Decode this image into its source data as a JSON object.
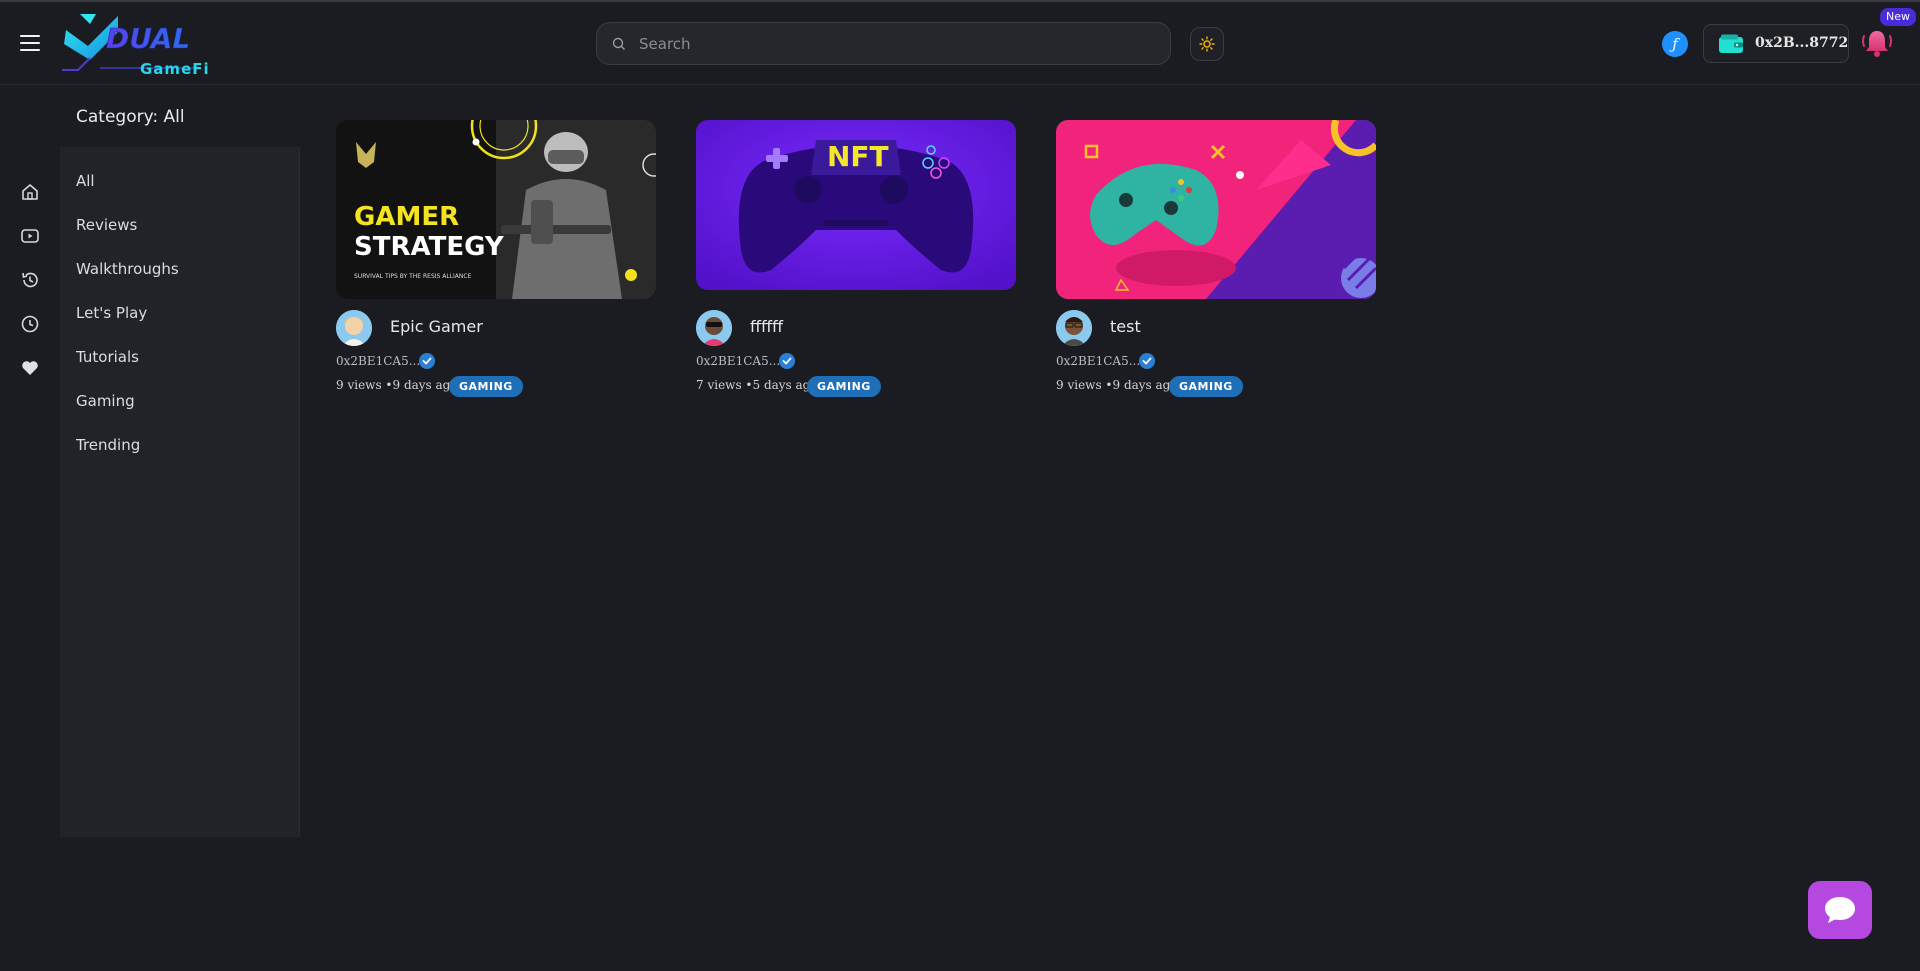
{
  "header": {
    "logo_text": "GameFi",
    "logo_wordmark": "DUAL",
    "search_placeholder": "Search",
    "wallet_address": "0x2B...8772",
    "notification_badge": "New"
  },
  "category_panel": {
    "title": "Category: All",
    "items": [
      "All",
      "Reviews",
      "Walkthroughs",
      "Let's Play",
      "Tutorials",
      "Gaming",
      "Trending"
    ]
  },
  "videos": [
    {
      "title": "Epic Gamer",
      "address": "0x2BE1CA5...",
      "meta": "9 views •9 days ago",
      "tag": "GAMING",
      "thumb_heading_1": "GAMER",
      "thumb_heading_2": "STRATEGY",
      "thumb_caption": "SURVIVAL TIPS BY THE RESIS ALLIANCE"
    },
    {
      "title": "ffffff",
      "address": "0x2BE1CA5...",
      "meta": "7 views •5 days ago",
      "tag": "GAMING",
      "thumb_heading_1": "NFT"
    },
    {
      "title": "test",
      "address": "0x2BE1CA5...",
      "meta": "9 views •9 days ago",
      "tag": "GAMING"
    }
  ],
  "colors": {
    "background": "#1b1c21",
    "panel": "#222328",
    "accent_cyan": "#27d8e8",
    "tag_blue": "#1f6fb8",
    "chat_purple": "#b548e0",
    "bell_pink": "#e0457b"
  },
  "icons": {
    "rail": [
      "home-icon",
      "video-icon",
      "history-icon",
      "clock-icon",
      "heart-icon"
    ]
  }
}
